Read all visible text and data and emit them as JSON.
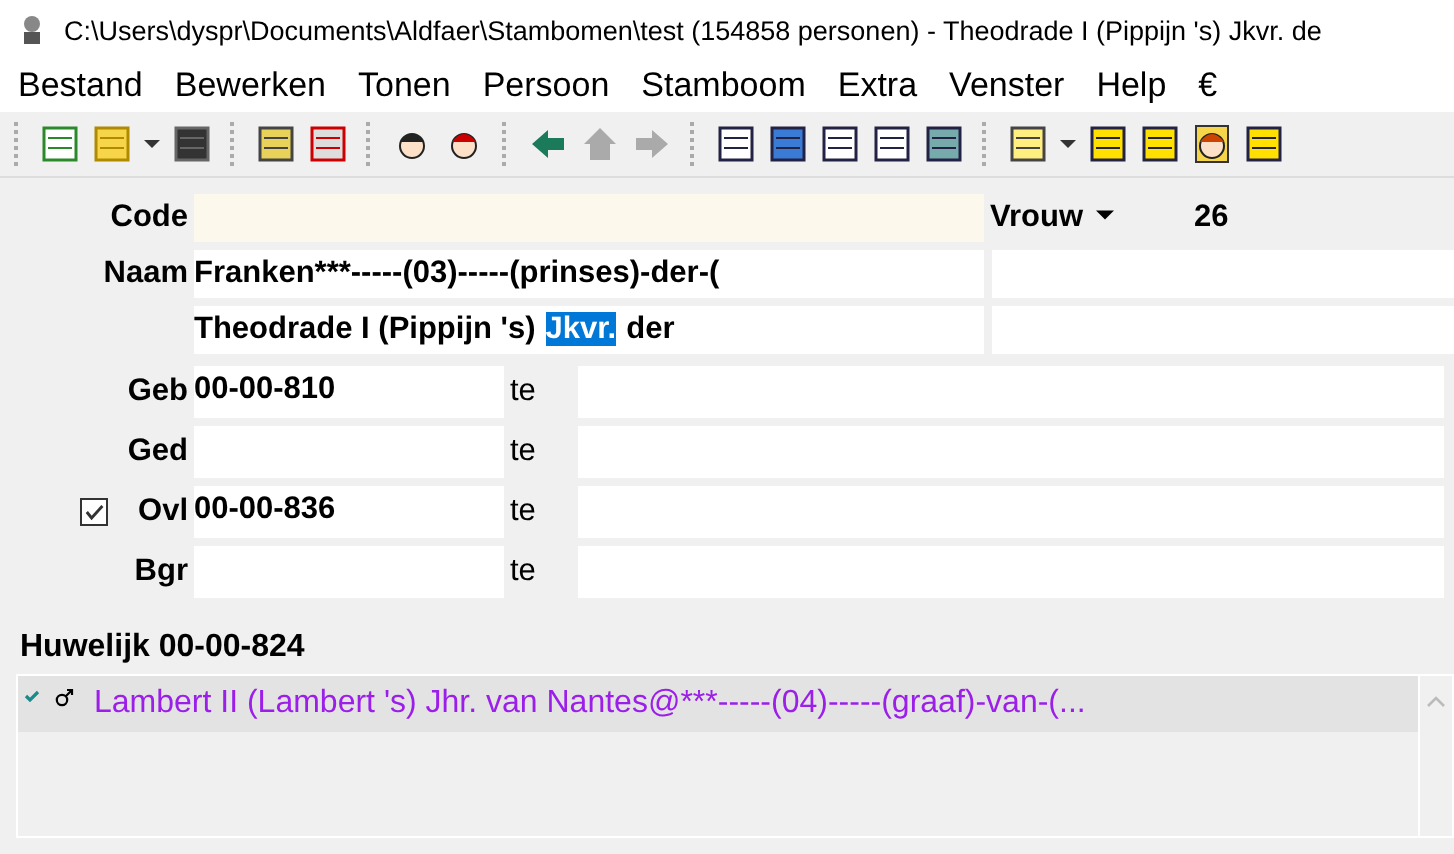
{
  "window": {
    "title": "C:\\Users\\dyspr\\Documents\\Aldfaer\\Stambomen\\test (154858 personen) - Theodrade I (Pippijn 's) Jkvr. de"
  },
  "menu": [
    "Bestand",
    "Bewerken",
    "Tonen",
    "Persoon",
    "Stamboom",
    "Extra",
    "Venster",
    "Help",
    "€"
  ],
  "person": {
    "code": {
      "label": "Code"
    },
    "sex": "Vrouw",
    "number": "26",
    "name": {
      "label": "Naam",
      "surname": "Franken***-----(03)-----(prinses)-der-(",
      "given_parts": [
        {
          "text": "Theodrade I (Pippijn 's)",
          "selected": false
        },
        {
          "text": "Jkvr.",
          "selected": true
        },
        {
          "text": "der",
          "selected": false
        }
      ]
    },
    "events": [
      {
        "label": "Geb",
        "date": "00-00-810",
        "place_label": "te",
        "checkbox": false
      },
      {
        "label": "Ged",
        "place_label": "te",
        "checkbox": false
      },
      {
        "label": "Ovl",
        "date": "00-00-836",
        "place_label": "te",
        "checkbox": true,
        "checked": true
      },
      {
        "label": "Bgr",
        "place_label": "te",
        "checkbox": false
      }
    ]
  },
  "marriage": {
    "heading": "Huwelijk 00-00-824",
    "partners": [
      {
        "name": "Lambert II (Lambert 's) Jhr. van Nantes@***-----(04)-----(graaf)-van-(...",
        "selected": true,
        "color": "#9b1fe8"
      }
    ]
  }
}
